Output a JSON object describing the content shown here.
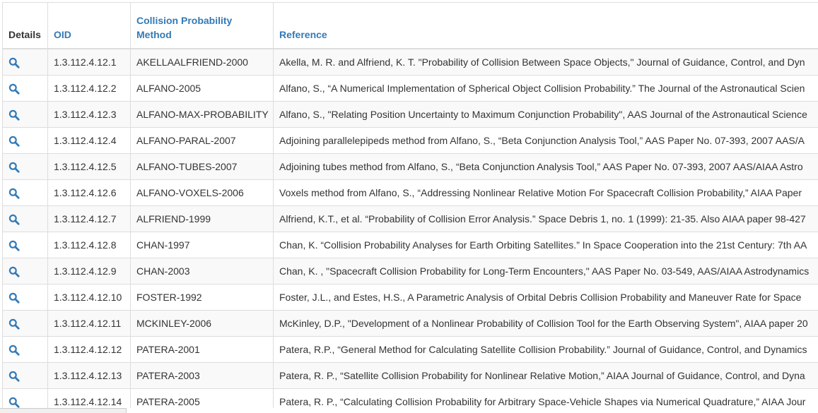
{
  "table": {
    "headers": {
      "details": "Details",
      "oid": "OID",
      "method": "Collision Probability Method",
      "reference": "Reference"
    },
    "rows": [
      {
        "oid": "1.3.112.4.12.1",
        "method": "AKELLAALFRIEND-2000",
        "reference": "Akella, M. R. and Alfriend, K. T. \"Probability of Collision Between Space Objects,\" Journal of Guidance, Control, and Dyn"
      },
      {
        "oid": "1.3.112.4.12.2",
        "method": "ALFANO-2005",
        "reference": "Alfano, S., “A Numerical Implementation of Spherical Object Collision Probability.” The Journal of the Astronautical Scien"
      },
      {
        "oid": "1.3.112.4.12.3",
        "method": "ALFANO-MAX-PROBABILITY",
        "reference": "Alfano, S., \"Relating Position Uncertainty to Maximum Conjunction Probability\", AAS Journal of the Astronautical Science"
      },
      {
        "oid": "1.3.112.4.12.4",
        "method": "ALFANO-PARAL-2007",
        "reference": "Adjoining parallelepipeds method from Alfano, S., “Beta Conjunction Analysis Tool,” AAS Paper No. 07-393, 2007 AAS/A"
      },
      {
        "oid": "1.3.112.4.12.5",
        "method": "ALFANO-TUBES-2007",
        "reference": "Adjoining tubes method from Alfano, S., “Beta Conjunction Analysis Tool,” AAS Paper No. 07-393, 2007 AAS/AIAA Astro"
      },
      {
        "oid": "1.3.112.4.12.6",
        "method": "ALFANO-VOXELS-2006",
        "reference": "Voxels method from Alfano, S., “Addressing Nonlinear Relative Motion For Spacecraft Collision Probability,” AIAA Paper"
      },
      {
        "oid": "1.3.112.4.12.7",
        "method": "ALFRIEND-1999",
        "reference": "Alfriend, K.T., et al. “Probability of Collision Error Analysis.” Space Debris 1, no. 1 (1999): 21-35. Also AIAA paper 98-427"
      },
      {
        "oid": "1.3.112.4.12.8",
        "method": "CHAN-1997",
        "reference": "Chan, K. “Collision Probability Analyses for Earth Orbiting Satellites.” In Space Cooperation into the 21st Century: 7th AA"
      },
      {
        "oid": "1.3.112.4.12.9",
        "method": "CHAN-2003",
        "reference": "Chan, K. , \"Spacecraft Collision Probability for Long-Term Encounters,\" AAS Paper No. 03-549, AAS/AIAA Astrodynamics"
      },
      {
        "oid": "1.3.112.4.12.10",
        "method": "FOSTER-1992",
        "reference": "Foster, J.L., and Estes, H.S., A Parametric Analysis of Orbital Debris Collision Probability and Maneuver Rate for Space"
      },
      {
        "oid": "1.3.112.4.12.11",
        "method": "MCKINLEY-2006",
        "reference": "McKinley, D.P., \"Development of a Nonlinear Probability of Collision Tool for the Earth Observing System\", AIAA paper 20"
      },
      {
        "oid": "1.3.112.4.12.12",
        "method": "PATERA-2001",
        "reference": "Patera, R.P., “General Method for Calculating Satellite Collision Probability.” Journal of Guidance, Control, and Dynamics"
      },
      {
        "oid": "1.3.112.4.12.13",
        "method": "PATERA-2003",
        "reference": "Patera, R. P., “Satellite Collision Probability for Nonlinear Relative Motion,” AIAA Journal of Guidance, Control, and Dyna"
      },
      {
        "oid": "1.3.112.4.12.14",
        "method": "PATERA-2005",
        "reference": "Patera, R. P., “Calculating Collision Probability for Arbitrary Space-Vehicle Shapes via Numerical Quadrature,” AIAA Jour"
      }
    ]
  },
  "icons": {
    "details": "search-icon"
  },
  "colors": {
    "link": "#337ab7",
    "text": "#333333",
    "stripe": "#f9f9f9",
    "border": "#dddddd"
  }
}
